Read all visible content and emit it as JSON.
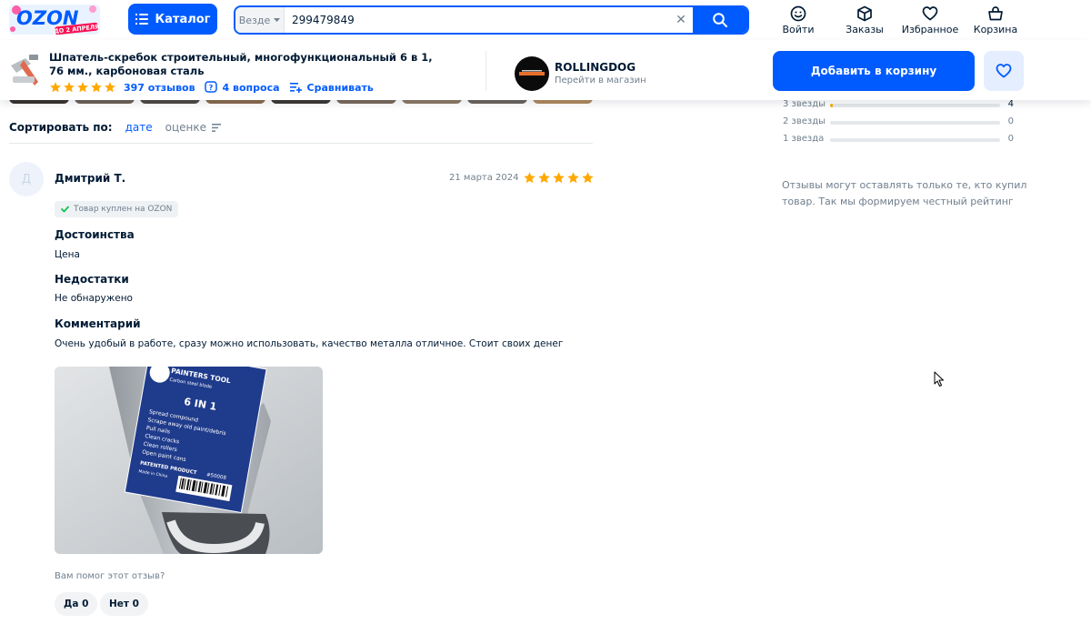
{
  "header": {
    "logo_text": "OZON",
    "logo_promo": "ДО 2 АПРЕЛЯ",
    "catalog_label": "Каталог",
    "search_scope": "Везде",
    "search_value": "299479849",
    "nav": [
      {
        "label": "Войти",
        "icon": "user-smile-icon"
      },
      {
        "label": "Заказы",
        "icon": "box-icon"
      },
      {
        "label": "Избранное",
        "icon": "heart-icon"
      },
      {
        "label": "Корзина",
        "icon": "basket-icon"
      }
    ],
    "accent_color": "#005bff"
  },
  "product": {
    "title": "Шпатель-скребок строительный, многофункциональный 6 в 1, 76 мм., карбоновая сталь",
    "rating_stars": 5,
    "reviews_label": "397 отзывов",
    "questions_label": "4 вопроса",
    "compare_label": "Сравнивать",
    "add_to_cart_label": "Добавить в корзину"
  },
  "seller": {
    "name": "ROLLINGDOG",
    "link_label": "Перейти в магазин"
  },
  "sort": {
    "label": "Сортировать по:",
    "option_date": "дате",
    "option_rating": "оценке"
  },
  "review": {
    "avatar_initial": "Д",
    "author": "Дмитрий Т.",
    "date": "21 марта 2024",
    "stars": 5,
    "verified_label": "Товар куплен на OZON",
    "pros_heading": "Достоинства",
    "pros_text": "Цена",
    "cons_heading": "Недостатки",
    "cons_text": "Не обнаружено",
    "comment_heading": "Комментарий",
    "comment_text": "Очень удобый в работе, сразу можно использовать, качество металла отличное. Стоит своих денег",
    "photo": {
      "brand_line": "PAINTERS TOOL",
      "sub_line": "Carbon steel blade",
      "model": "6 IN 1",
      "features": [
        "Spread compound",
        "Scrape away old paint/debris",
        "Pull nails",
        "Clean cracks",
        "Clean rollers",
        "Open paint cans"
      ],
      "patent": "PATENTED PRODUCT",
      "sku": "#50008",
      "origin": "Made in China"
    },
    "helpful_question": "Вам помог этот отзыв?",
    "yes_label": "Да 0",
    "no_label": "Нет 0"
  },
  "rating_breakdown": [
    {
      "label": "3 звезды",
      "count": "4",
      "fill_percent": 1.5
    },
    {
      "label": "2 звезды",
      "count": "0",
      "fill_percent": 0
    },
    {
      "label": "1 звезда",
      "count": "0",
      "fill_percent": 0
    }
  ],
  "rating_note": "Отзывы могут оставлять только те, кто купил товар. Так мы формируем честный рейтинг",
  "colors": {
    "star": "#ffa800",
    "verified_check": "#10c44c",
    "muted": "#707f8d"
  }
}
